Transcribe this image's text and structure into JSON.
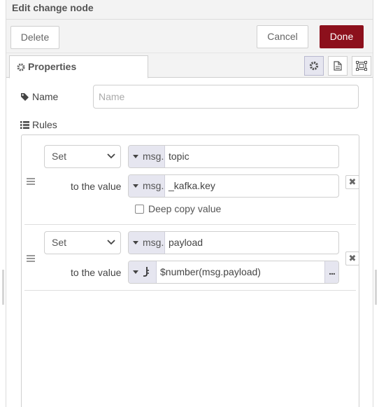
{
  "header": {
    "title": "Edit change node"
  },
  "toolbar": {
    "delete_label": "Delete",
    "cancel_label": "Cancel",
    "done_label": "Done"
  },
  "tabs": {
    "properties_label": "Properties"
  },
  "name_field": {
    "label": "Name",
    "placeholder": "Name",
    "value": ""
  },
  "rules": {
    "label": "Rules",
    "items": [
      {
        "action": "Set",
        "target_type": "msg.",
        "target_value": "topic",
        "to_label": "to the value",
        "value_type": "msg.",
        "value": "_kafka.key",
        "deep_copy_label": "Deep copy value"
      },
      {
        "action": "Set",
        "target_type": "msg.",
        "target_value": "payload",
        "to_label": "to the value",
        "value_type_icon": "jsonata-icon",
        "value": "$number(msg.payload)",
        "expand_label": "..."
      }
    ]
  },
  "colors": {
    "done_button": "#8c101c",
    "typed_input_button": "#e6e6f0"
  }
}
